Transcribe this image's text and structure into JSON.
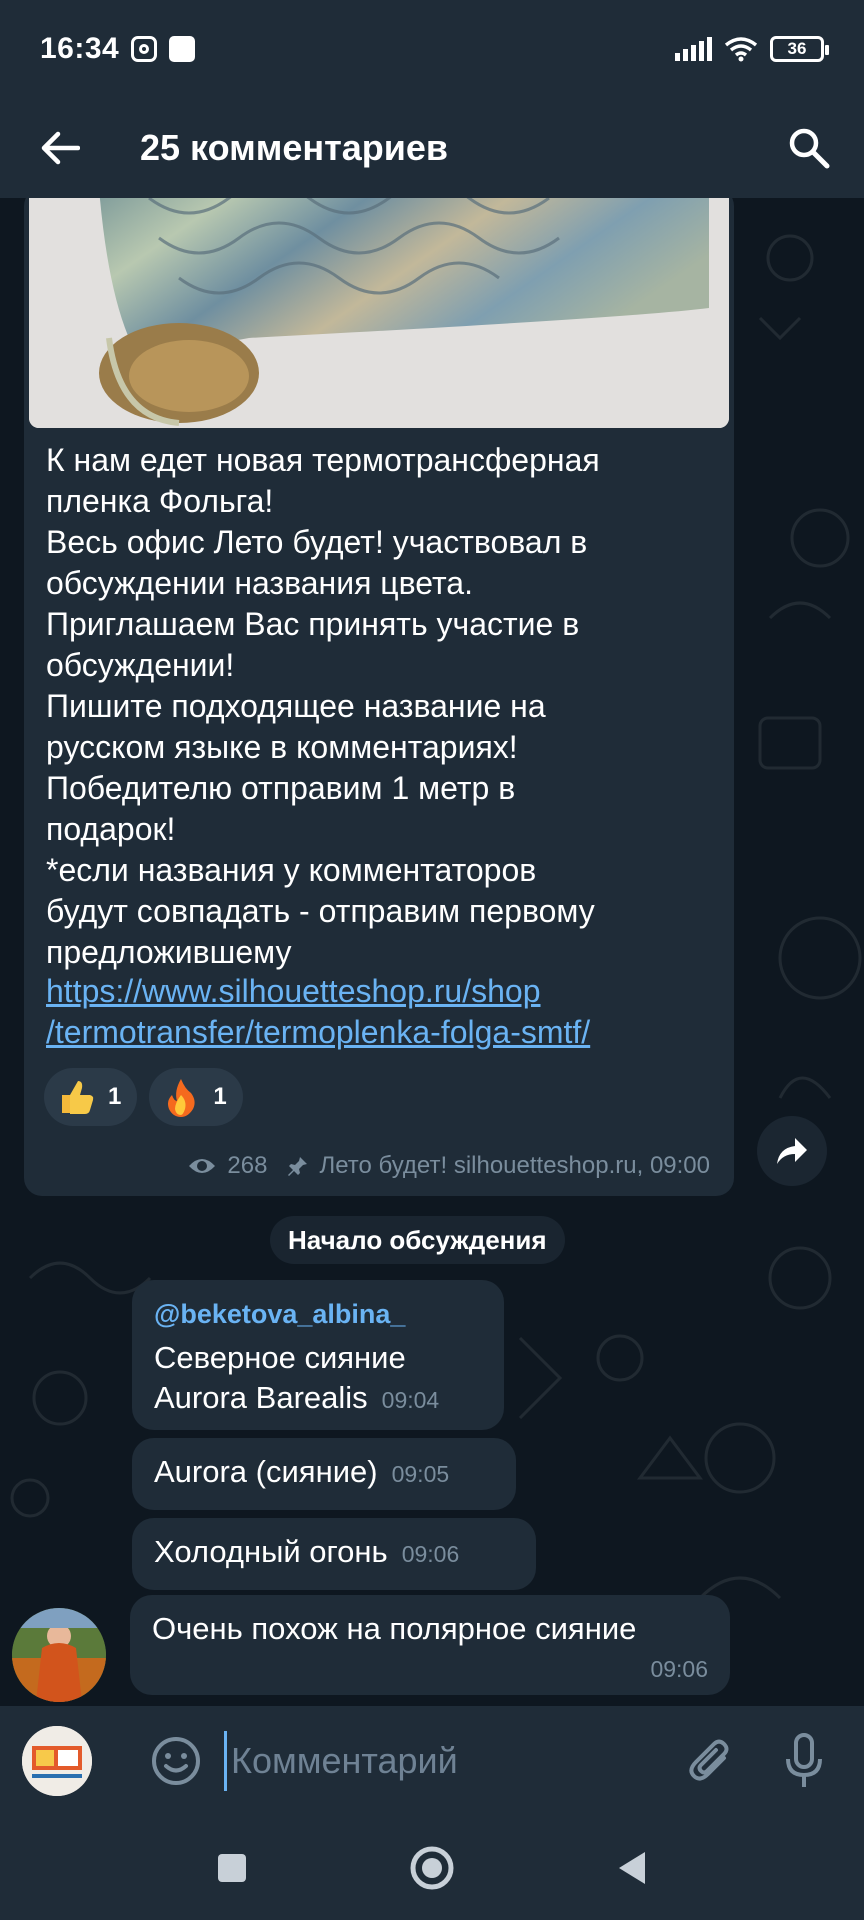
{
  "status_bar": {
    "time": "16:34",
    "battery": "36"
  },
  "header": {
    "title": "25 комментариев"
  },
  "post": {
    "text": "К нам едет новая термотрансферная\nпленка Фольга!\nВесь офис Лето будет! участвовал в\nобсуждении названия цвета.\nПриглашаем Вас принять участие в\nобсуждении!\nПишите подходящее название на\nрусском языке в комментариях!\nПобедителю отправим 1 метр в\nподарок!\n*если названия у комментаторов\nбудут совпадать - отправим первому\nпредложившему",
    "link": "https://www.silhouetteshop.ru/shop\n/termotransfer/termoplenka-folga-smtf/",
    "reactions": [
      {
        "icon": "thumbs-up-icon",
        "count": "1"
      },
      {
        "icon": "fire-icon",
        "count": "1"
      }
    ],
    "views": "268",
    "footer": "Лето будет! silhouetteshop.ru, 09:00"
  },
  "discussion_label": "Начало обсуждения",
  "messages": [
    {
      "author": "@beketova_albina_",
      "text": "Северное сияние\nAurora Barealis",
      "time": "09:04"
    },
    {
      "text": "Aurora (сияние)",
      "time": "09:05"
    },
    {
      "text": "Холодный огонь",
      "time": "09:06"
    },
    {
      "text": "Очень похож на полярное сияние",
      "time": "09:06"
    }
  ],
  "input": {
    "placeholder": "Комментарий"
  },
  "colors": {
    "bubble": "#1f2c38",
    "link": "#6ab3f3",
    "background": "#0e1720"
  }
}
